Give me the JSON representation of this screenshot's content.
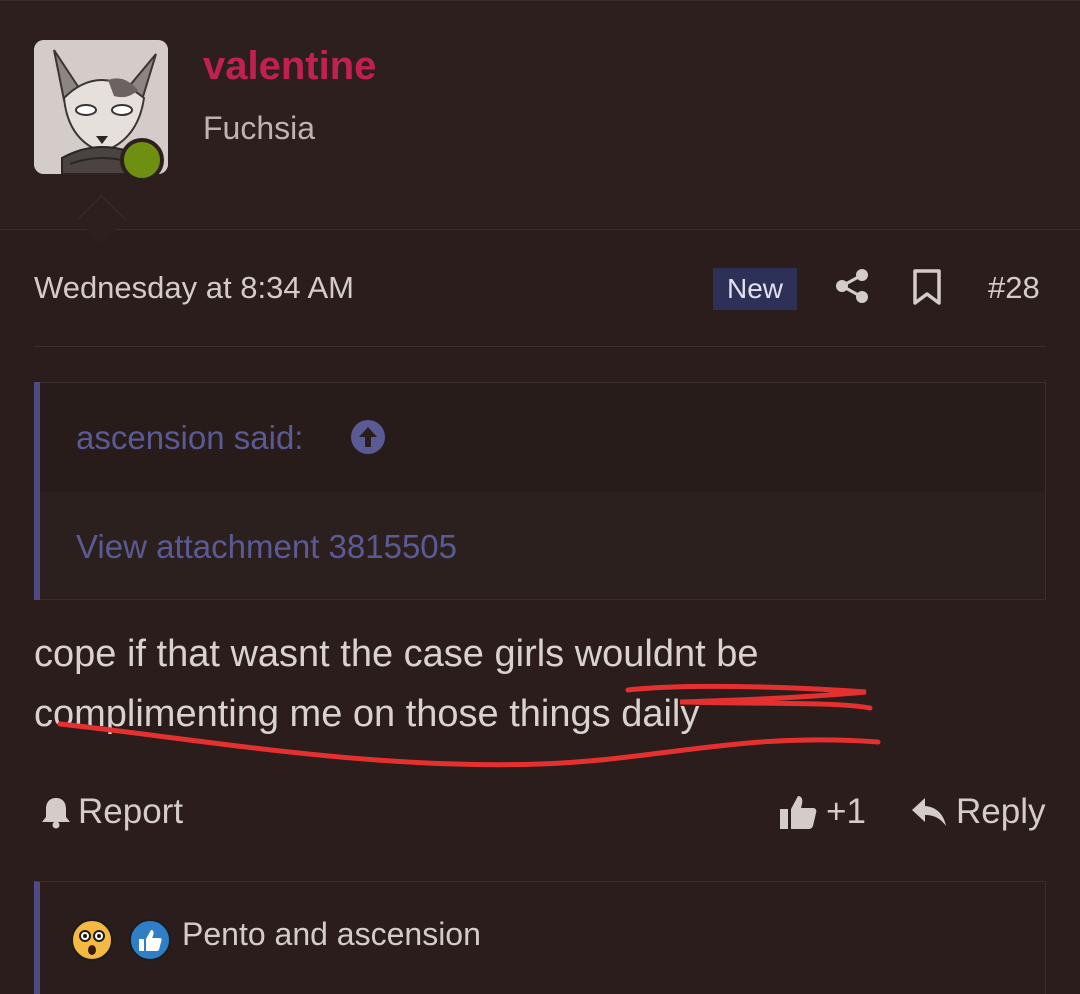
{
  "post": {
    "user": {
      "name": "valentine",
      "title": "Fuchsia",
      "avatar_icon": "fox-avatar",
      "status": "online"
    },
    "timestamp": "Wednesday at 8:34 AM",
    "badge": "New",
    "post_number": "#28",
    "quote": {
      "author": "ascension said:",
      "attachment_link": "View attachment 3815505"
    },
    "message": "cope if that wasnt the case girls wouldnt be complimenting me on those things daily",
    "actions": {
      "report": "Report",
      "like_count": "+1",
      "reply": "Reply"
    },
    "reactions": {
      "icons": [
        "wow-reaction-icon",
        "like-reaction-icon"
      ],
      "text": "Pento and ascension"
    }
  },
  "colors": {
    "background": "#2a1d1c",
    "username": "#c2214f",
    "link": "#5a5a94",
    "quote_border": "#4f4a82",
    "badge_bg": "#2d3158",
    "status_online": "#6e8f10",
    "annotation_red": "#e53030"
  }
}
